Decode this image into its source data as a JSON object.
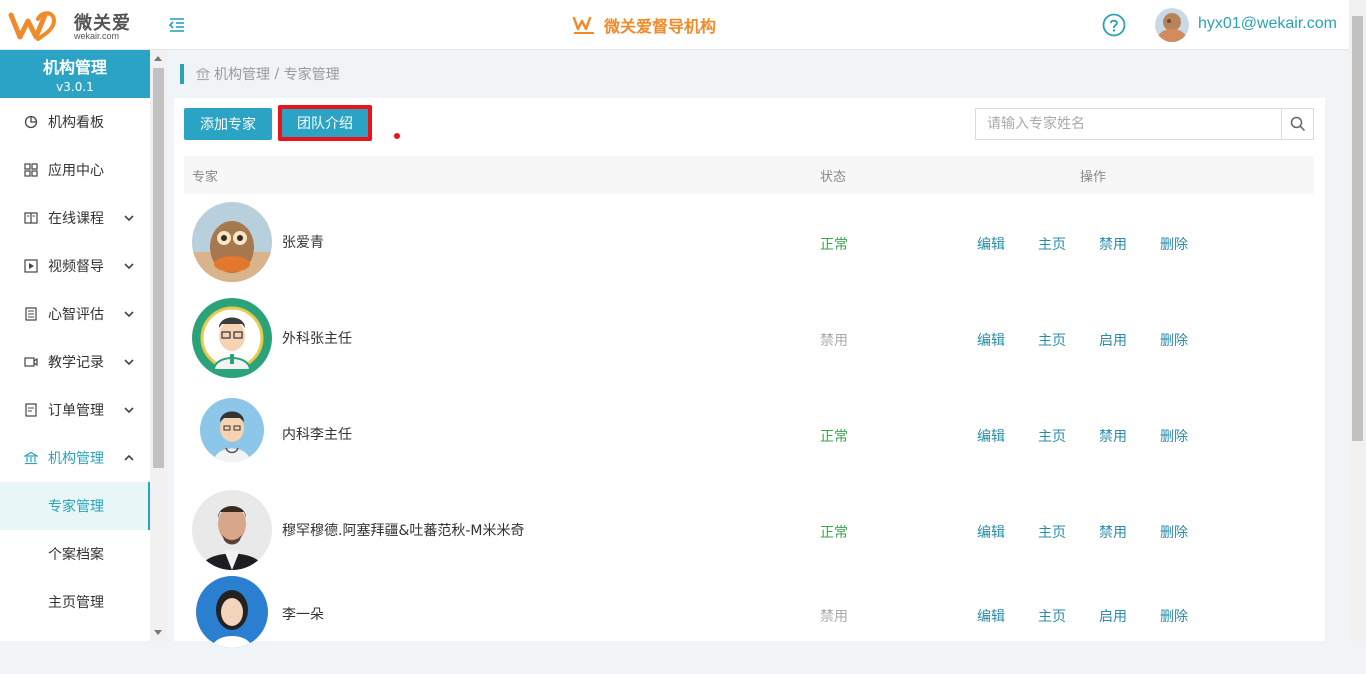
{
  "header": {
    "logo_name": "微关爱",
    "logo_url": "wekair.com",
    "center_title": "微关爱督导机构",
    "user_email": "hyx01@wekair.com"
  },
  "sidebar": {
    "title": "机构管理",
    "version": "v3.0.1",
    "items": [
      {
        "label": "机构看板",
        "icon": "pie-chart-icon"
      },
      {
        "label": "应用中心",
        "icon": "grid-icon"
      },
      {
        "label": "在线课程",
        "icon": "book-icon"
      },
      {
        "label": "视频督导",
        "icon": "play-icon"
      },
      {
        "label": "心智评估",
        "icon": "list-icon"
      },
      {
        "label": "教学记录",
        "icon": "video-icon"
      },
      {
        "label": "订单管理",
        "icon": "document-icon"
      },
      {
        "label": "机构管理",
        "icon": "institution-icon"
      }
    ],
    "sub_items": [
      "专家管理",
      "个案档案",
      "主页管理"
    ]
  },
  "breadcrumb": {
    "root": "机构管理",
    "separator": " / ",
    "current": "专家管理"
  },
  "toolbar": {
    "add_label": "添加专家",
    "team_label": "团队介绍",
    "search_placeholder": "请输入专家姓名"
  },
  "table": {
    "headers": [
      "专家",
      "状态",
      "操作"
    ],
    "rows": [
      {
        "name": "张爱青",
        "status": "正常",
        "active": true,
        "ops": [
          "编辑",
          "主页",
          "禁用",
          "删除"
        ]
      },
      {
        "name": "外科张主任",
        "status": "禁用",
        "active": false,
        "ops": [
          "编辑",
          "主页",
          "启用",
          "删除"
        ]
      },
      {
        "name": "内科李主任",
        "status": "正常",
        "active": true,
        "ops": [
          "编辑",
          "主页",
          "禁用",
          "删除"
        ]
      },
      {
        "name": "穆罕穆德.阿塞拜疆&吐蕃范秋-M米米奇",
        "status": "正常",
        "active": true,
        "ops": [
          "编辑",
          "主页",
          "禁用",
          "删除"
        ]
      },
      {
        "name": "李一朵",
        "status": "禁用",
        "active": false,
        "ops": [
          "编辑",
          "主页",
          "启用",
          "删除"
        ]
      }
    ]
  },
  "colors": {
    "accent": "#2aa3c4",
    "brand_orange": "#f08b2c",
    "status_on": "#36a84c",
    "status_off": "#aaaaaa",
    "highlight_red": "#e8141a"
  }
}
